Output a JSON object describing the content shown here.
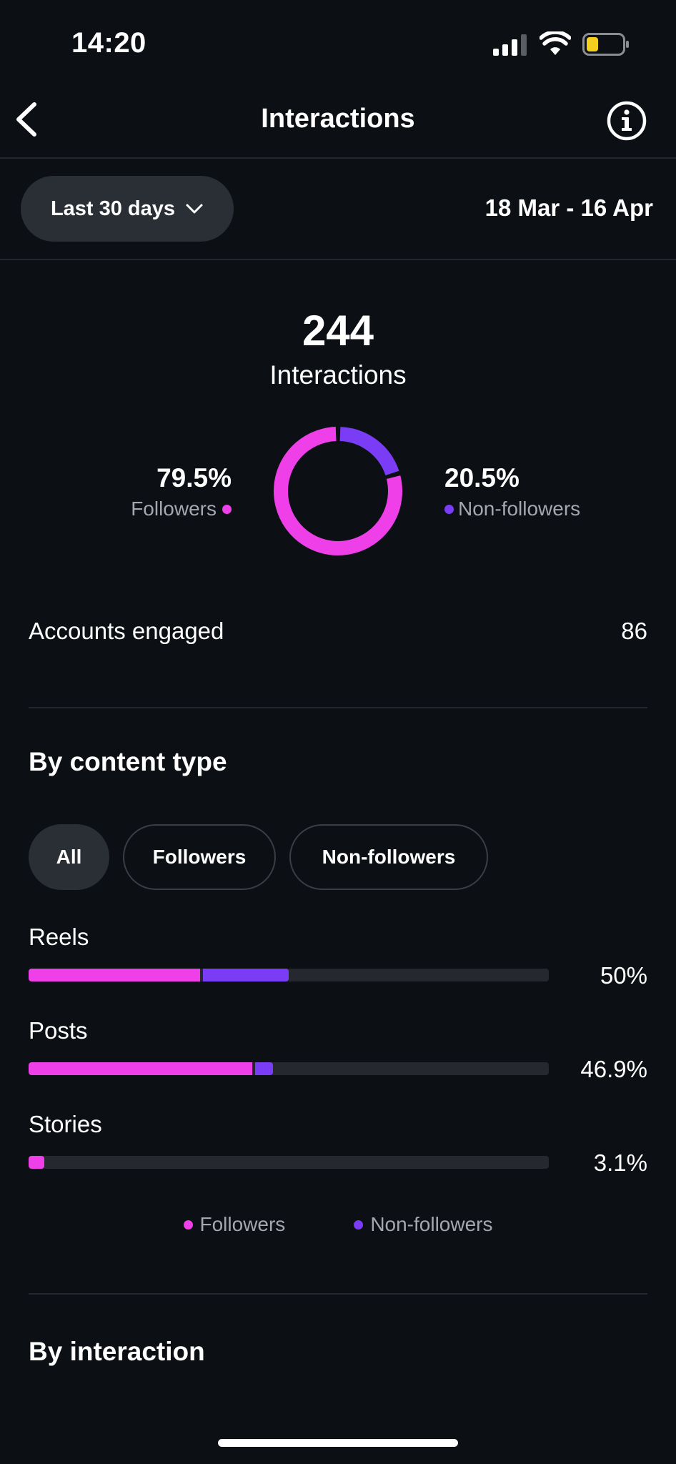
{
  "status_bar": {
    "time": "14:20"
  },
  "header": {
    "title": "Interactions",
    "back_icon": "chevron-left-icon",
    "info_icon": "info-icon"
  },
  "filter": {
    "range_label": "Last 30 days",
    "date_range": "18 Mar - 16 Apr"
  },
  "colors": {
    "followers": "#ee3fe8",
    "non_followers": "#7a3cf5",
    "background": "#0c0f14"
  },
  "summary": {
    "total": "244",
    "label": "Interactions",
    "followers_pct": "79.5%",
    "followers_label": "Followers",
    "non_followers_pct": "20.5%",
    "non_followers_label": "Non-followers",
    "followers_share": 0.795,
    "non_followers_share": 0.205
  },
  "accounts_engaged": {
    "label": "Accounts engaged",
    "value": "86"
  },
  "content_type": {
    "heading": "By content type",
    "chips": [
      "All",
      "Followers",
      "Non-followers"
    ],
    "active_chip": "All",
    "rows": [
      {
        "label": "Reels",
        "pct": "50%",
        "followers_fraction": 0.33,
        "non_followers_fraction": 0.17
      },
      {
        "label": "Posts",
        "pct": "46.9%",
        "followers_fraction": 0.43,
        "non_followers_fraction": 0.04
      },
      {
        "label": "Stories",
        "pct": "3.1%",
        "followers_fraction": 0.03,
        "non_followers_fraction": 0.0
      }
    ],
    "legend": {
      "followers": "Followers",
      "non_followers": "Non-followers"
    }
  },
  "interaction_section": {
    "heading": "By interaction"
  }
}
